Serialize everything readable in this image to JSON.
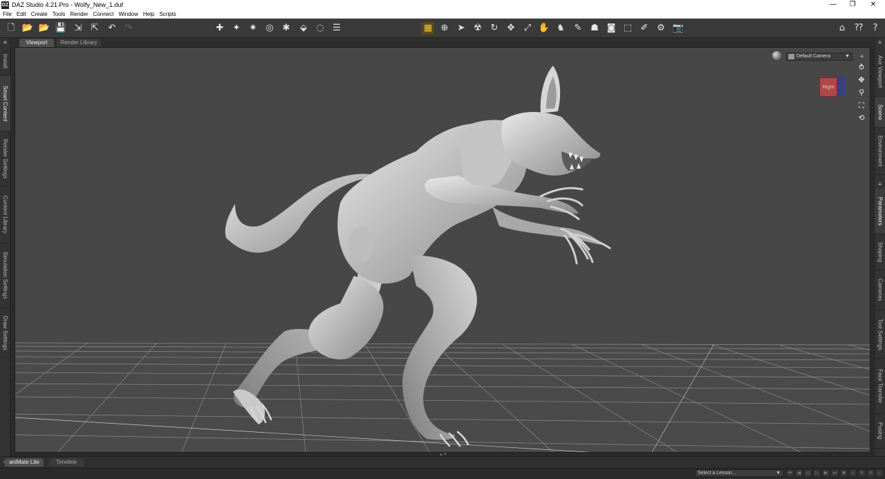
{
  "window": {
    "title": "DAZ Studio 4.21 Pro - Wolfy_New_1.duf",
    "app_icon_text": "DZ",
    "controls": [
      "—",
      "❐",
      "✕"
    ]
  },
  "menu": [
    "File",
    "Edit",
    "Create",
    "Tools",
    "Render",
    "Connect",
    "Window",
    "Help",
    "Scripts"
  ],
  "left_tabs": [
    "Install",
    "Smart Content",
    "Render Settings",
    "Content Library",
    "Simulation Settings",
    "Draw Settings"
  ],
  "right_tabs_top": [
    "Aux Viewport",
    "Scene",
    "Environment"
  ],
  "right_tabs_bottom": [
    "Parameters",
    "Shaping",
    "Cameras",
    "Tool Settings",
    "Face Transfer",
    "Posing"
  ],
  "viewport_tabs": [
    "Viewport",
    "Render Library"
  ],
  "camera": {
    "selected": "Default Camera"
  },
  "view_cube": {
    "face_label": "Right"
  },
  "bottom_tabs": [
    "aniMate Lite",
    "Timeline"
  ],
  "lesson": {
    "placeholder": "Select a Lesson..."
  },
  "colors": {
    "viewport_bg": "#474747",
    "chrome_bg": "#3a3a3a",
    "active_tool": "#f0c040",
    "view_cube_face": "#b24747"
  }
}
